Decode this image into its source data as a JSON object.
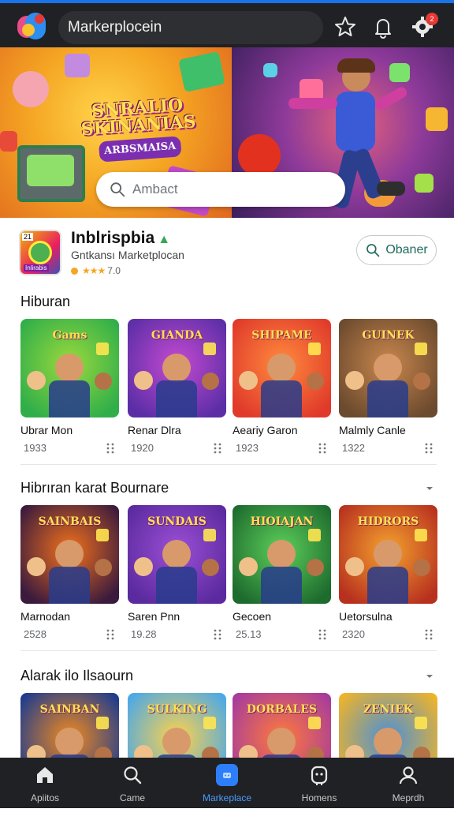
{
  "header": {
    "search_text": "Markerplocein",
    "notification_count": "2",
    "icons": [
      "app-logo-icon",
      "star-icon",
      "bell-icon",
      "settings-icon"
    ]
  },
  "banner": {
    "title_line1": "SNRALIO",
    "title_line2": "SKINANIAS",
    "title_sub": "ARBSMAISA",
    "search_placeholder": "Ambact"
  },
  "app": {
    "icon_tag": "21",
    "icon_label": "Inlirabis",
    "name": "Inblrispbia",
    "subtitle": "Gntkansı Marketplocan",
    "rating_text": "7.0",
    "obtain_label": "Obaner"
  },
  "sections": [
    {
      "title": "Hiburan",
      "cards": [
        {
          "name": "Ubrar Mon",
          "count": "1933",
          "thumb_title": "Gams",
          "colors": [
            "#2fae4a",
            "#9ad93c"
          ]
        },
        {
          "name": "Renar Dlra",
          "count": "1920",
          "thumb_title": "GIANDA",
          "colors": [
            "#5b2ea6",
            "#c44ad1"
          ]
        },
        {
          "name": "Aeariy Garon",
          "count": "1923",
          "thumb_title": "SHIPAME",
          "colors": [
            "#e03a2b",
            "#ff8a3d"
          ]
        },
        {
          "name": "Malmly Canle",
          "count": "1322",
          "thumb_title": "GUINEK",
          "colors": [
            "#6b4a2e",
            "#c9874d"
          ]
        }
      ]
    },
    {
      "title": "Hibrıran karat Bournare",
      "cards": [
        {
          "name": "Marnodan",
          "count": "2528",
          "thumb_title": "SAINBAIS",
          "colors": [
            "#3a1a3d",
            "#f2711c"
          ]
        },
        {
          "name": "Saren Pnn",
          "count": "19.28",
          "thumb_title": "SUNDAIS",
          "colors": [
            "#5a2a9e",
            "#9c4fd6"
          ]
        },
        {
          "name": "Gecoen",
          "count": "25.13",
          "thumb_title": "HIOIAJAN",
          "colors": [
            "#1e6b2e",
            "#5ccf5a"
          ]
        },
        {
          "name": "Uetorsulna",
          "count": "2320",
          "thumb_title": "HIDRORS",
          "colors": [
            "#b8311f",
            "#f4a22e"
          ]
        }
      ]
    },
    {
      "title": "Alarak ilo Ilsaourn",
      "cards": [
        {
          "name": "",
          "count": "",
          "thumb_title": "SAINBAN",
          "colors": [
            "#1c3b8f",
            "#f28a1e"
          ]
        },
        {
          "name": "",
          "count": "",
          "thumb_title": "SULKING",
          "colors": [
            "#4aa8e8",
            "#ffd24a"
          ]
        },
        {
          "name": "",
          "count": "",
          "thumb_title": "DORBALES",
          "colors": [
            "#a53b9e",
            "#ff7a3a"
          ]
        },
        {
          "name": "",
          "count": "",
          "thumb_title": "ZENIEK",
          "colors": [
            "#f0b429",
            "#4a8fd8"
          ]
        }
      ]
    }
  ],
  "bottom_nav": [
    {
      "label": "Apiitos",
      "icon": "home-icon",
      "active": false
    },
    {
      "label": "Came",
      "icon": "search-icon",
      "active": false
    },
    {
      "label": "Markeplace",
      "icon": "marketplace-icon",
      "active": true
    },
    {
      "label": "Homens",
      "icon": "gamepad-icon",
      "active": false
    },
    {
      "label": "Meprdh",
      "icon": "profile-icon",
      "active": false
    }
  ],
  "colors": {
    "accent": "#2d7ff9",
    "bar_dark": "#202124",
    "obtain_text": "#1e6b5c"
  }
}
